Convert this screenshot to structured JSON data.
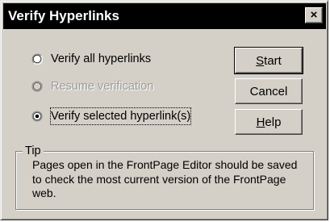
{
  "window": {
    "title": "Verify Hyperlinks",
    "close_glyph": "×"
  },
  "options": [
    {
      "label": "Verify all hyperlinks",
      "selected": false,
      "disabled": false
    },
    {
      "label": "Resume verification",
      "selected": false,
      "disabled": true
    },
    {
      "label": "Verify selected hyperlink(s)",
      "selected": true,
      "disabled": false
    }
  ],
  "buttons": {
    "start": {
      "mnemonic": "S",
      "rest": "tart"
    },
    "cancel": {
      "label": "Cancel"
    },
    "help": {
      "mnemonic": "H",
      "rest": "elp"
    }
  },
  "tip": {
    "title": "Tip",
    "text": "Pages open in the FrontPage Editor should be saved to check the most current version of the FrontPage web."
  },
  "colors": {
    "face": "#d4d0c8",
    "titlebar": "#000000",
    "disabled_text": "#9c9c9c"
  }
}
